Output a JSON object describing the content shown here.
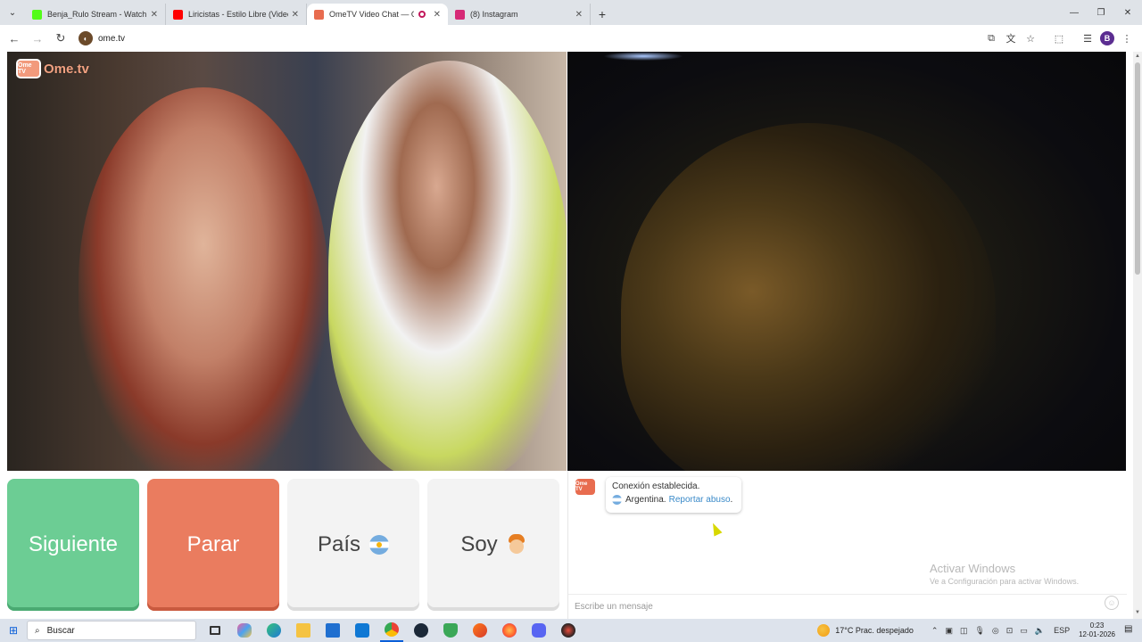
{
  "browser": {
    "tabs": [
      {
        "title": "Benja_Rulo Stream - Watch Live",
        "favicon_color": "#53fc18",
        "active": false
      },
      {
        "title": "Liricistas - Estilo Libre (Video Of",
        "favicon_color": "#ff0000",
        "active": false
      },
      {
        "title": "OmeTV Video Chat — Ome",
        "favicon_color": "#e86c4f",
        "active": true
      },
      {
        "title": "(8) Instagram",
        "favicon_color": "#d62976",
        "active": false
      }
    ],
    "url": "ome.tv",
    "profile_initial": "B"
  },
  "ometv": {
    "logo_badge": "Ome TV",
    "logo_text": "Ome.tv"
  },
  "controls": {
    "next_label": "Siguiente",
    "stop_label": "Parar",
    "country_label": "País",
    "gender_label": "Soy"
  },
  "chat": {
    "avatar_label": "Ome TV",
    "status": "Conexión establecida.",
    "country": "Argentina.",
    "report_link": "Reportar abuso",
    "report_suffix": ".",
    "input_placeholder": "Escribe un mensaje"
  },
  "windows": {
    "activate_title": "Activar Windows",
    "activate_sub": "Ve a Configuración para activar Windows.",
    "search_placeholder": "Buscar",
    "weather": "17°C   Prac. despejado",
    "language": "ESP",
    "time": "0:23",
    "date": "12-01-2026"
  },
  "colors": {
    "next": "#6ccd94",
    "stop": "#ea7c5f",
    "neutral": "#f3f3f3",
    "link": "#3a8ac9"
  }
}
